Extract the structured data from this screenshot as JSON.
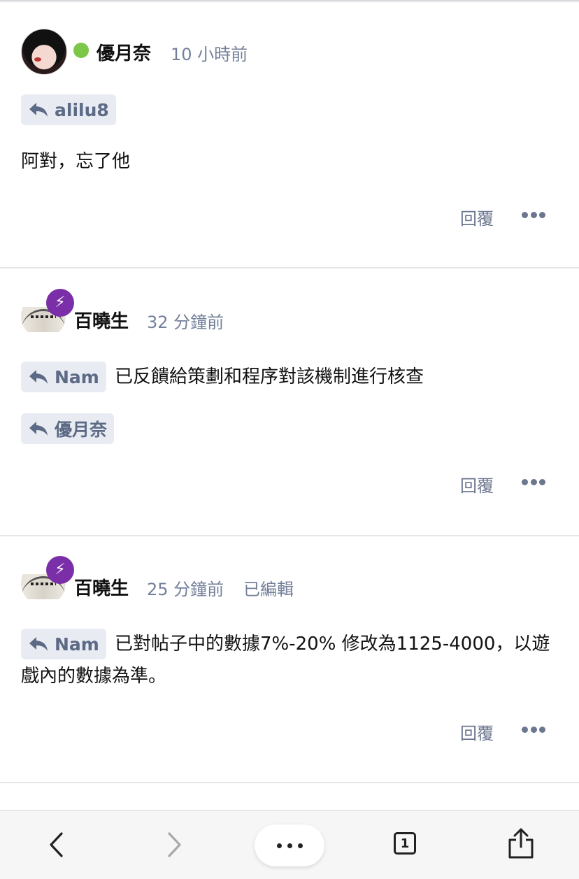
{
  "posts": [
    {
      "username": "優月奈",
      "time": "10 小時前",
      "edited": "",
      "replies_to": [
        "alilu8"
      ],
      "body": "阿對，忘了他",
      "reply_label": "回覆"
    },
    {
      "username": "百曉生",
      "time": "32 分鐘前",
      "edited": "",
      "replies_to": [
        "Nam",
        "優月奈"
      ],
      "body": "已反饋給策劃和程序對該機制進行核查",
      "reply_label": "回覆"
    },
    {
      "username": "百曉生",
      "time": "25 分鐘前",
      "edited": "已編輯",
      "replies_to": [
        "Nam"
      ],
      "body": "已對帖子中的數據7%-20% 修改為1125-4000，以遊戲內的數據為準。",
      "reply_label": "回覆"
    }
  ],
  "toolbar": {
    "tab_count": "1",
    "icons": [
      "back-icon",
      "forward-icon",
      "more-icon",
      "tabs-icon",
      "share-icon"
    ]
  },
  "colors": {
    "online": "#7cc64a",
    "badge": "#7a2fa8",
    "meta": "#74809a",
    "reply_tag_bg": "#e8ebf2"
  }
}
